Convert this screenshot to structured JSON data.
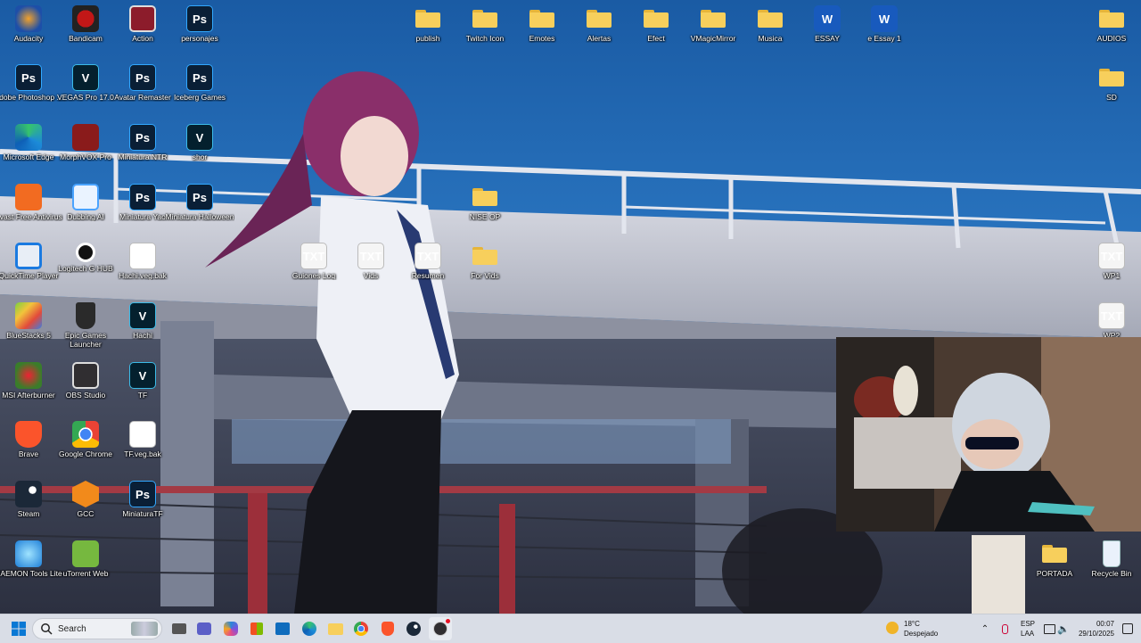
{
  "desktop": {
    "col1": [
      {
        "label": "Audacity",
        "icon": "audacity-icon"
      },
      {
        "label": "Adobe Photoshop ...",
        "icon": "photoshop-icon"
      },
      {
        "label": "Microsoft Edge",
        "icon": "edge-icon"
      },
      {
        "label": "Avast Free Antivirus",
        "icon": "avast-icon"
      },
      {
        "label": "QuickTime Player",
        "icon": "quicktime-icon"
      },
      {
        "label": "BlueStacks 5",
        "icon": "bluestacks-icon"
      },
      {
        "label": "MSI Afterburner",
        "icon": "afterburner-icon"
      },
      {
        "label": "Brave",
        "icon": "brave-icon"
      },
      {
        "label": "Steam",
        "icon": "steam-icon"
      },
      {
        "label": "DAEMON Tools Lite",
        "icon": "daemon-tools-icon"
      }
    ],
    "col2": [
      {
        "label": "Bandicam",
        "icon": "bandicam-icon"
      },
      {
        "label": "VEGAS Pro 17.0",
        "icon": "vegas-icon"
      },
      {
        "label": "MorphVOX Pro",
        "icon": "morphvox-icon"
      },
      {
        "label": "Dubbing AI",
        "icon": "dubbing-ai-icon"
      },
      {
        "label": "Logitech G HUB",
        "icon": "logitech-icon"
      },
      {
        "label": "Epic Games Launcher",
        "icon": "epic-games-icon"
      },
      {
        "label": "OBS Studio",
        "icon": "obs-icon"
      },
      {
        "label": "Google Chrome",
        "icon": "chrome-icon"
      },
      {
        "label": "GCC",
        "icon": "gcc-icon"
      },
      {
        "label": "uTorrent Web",
        "icon": "utorrent-icon"
      }
    ],
    "col3": [
      {
        "label": "Action",
        "icon": "action-icon"
      },
      {
        "label": "Avatar Remaster",
        "icon": "photoshop-file-icon"
      },
      {
        "label": "Miniatura NTR",
        "icon": "photoshop-file-icon"
      },
      {
        "label": "Miniatura Yao",
        "icon": "photoshop-file-icon"
      },
      {
        "label": "Hachi.veg.bak",
        "icon": "file-icon"
      },
      {
        "label": "Hachi",
        "icon": "vegas-file-icon"
      },
      {
        "label": "TF",
        "icon": "vegas-file-icon"
      },
      {
        "label": "TF.veg.bak",
        "icon": "file-icon"
      },
      {
        "label": "MiniaturaTF",
        "icon": "photoshop-file-icon"
      }
    ],
    "col4": [
      {
        "label": "personajes",
        "icon": "photoshop-file-icon"
      },
      {
        "label": "Iceberg Games",
        "icon": "photoshop-file-icon"
      },
      {
        "label": "shor",
        "icon": "vegas-file-icon"
      },
      {
        "label": "Miniatura Halloween",
        "icon": "photoshop-file-icon"
      }
    ],
    "top_row": [
      {
        "label": "publish",
        "icon": "folder-icon"
      },
      {
        "label": "Twitch Icon",
        "icon": "folder-icon"
      },
      {
        "label": "Emotes",
        "icon": "folder-icon"
      },
      {
        "label": "Alertas",
        "icon": "folder-icon"
      },
      {
        "label": "Efect",
        "icon": "folder-icon"
      },
      {
        "label": "VMagicMirror",
        "icon": "folder-icon"
      },
      {
        "label": "Musica",
        "icon": "folder-icon"
      },
      {
        "label": "ESSAY",
        "icon": "word-icon"
      },
      {
        "label": "e Essay 1",
        "icon": "word-icon"
      }
    ],
    "middle": [
      {
        "label": "Guiones Loq",
        "icon": "txt-icon"
      },
      {
        "label": "Vids",
        "icon": "txt-icon"
      },
      {
        "label": "Resumen",
        "icon": "txt-icon"
      },
      {
        "label": "For Vids",
        "icon": "folder-icon"
      },
      {
        "label": "NISE OP",
        "icon": "folder-icon"
      }
    ],
    "right": [
      {
        "label": "AUDIOS",
        "icon": "folder-icon"
      },
      {
        "label": "SD",
        "icon": "folder-icon"
      },
      {
        "label": "WP1",
        "icon": "txt-icon"
      },
      {
        "label": "WP2",
        "icon": "txt-icon"
      },
      {
        "label": "PORTADA",
        "icon": "folder-icon"
      },
      {
        "label": "Recycle Bin",
        "icon": "recycle-bin-icon"
      }
    ],
    "txt_badge": "TXT",
    "ps_badge": "Ps",
    "v_badge": "V"
  },
  "taskbar": {
    "search_label": "Search",
    "weather_temp": "18°C",
    "weather_desc": "Despejado",
    "lang_top": "ESP",
    "lang_bottom": "LAA",
    "time": "00:07",
    "date": "29/10/2025",
    "apps": [
      "start-icon",
      "file-explorer-preview-icon",
      "task-view-icon",
      "teams-icon",
      "copilot-icon",
      "store-icon",
      "outlook-icon",
      "edge-icon",
      "file-explorer-icon",
      "chrome-icon",
      "brave-icon",
      "steam-icon",
      "obs-icon"
    ]
  },
  "colors": {
    "folder": "#f7cf5c",
    "ps_blue": "#31a8ff",
    "taskbar": "#d9dde6"
  }
}
